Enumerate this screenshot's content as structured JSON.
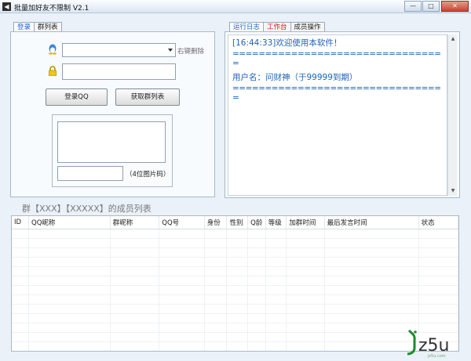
{
  "window": {
    "title": "批量加好友不限制 V2.1",
    "min": "—",
    "max": "□",
    "close": "✕"
  },
  "left_tabs": [
    "登录",
    "群列表"
  ],
  "login": {
    "account_placeholder": "",
    "right_click_delete": "右键删除",
    "password_placeholder": "",
    "login_button": "登录QQ",
    "fetch_groups_button": "获取群列表",
    "captcha_hint": "（4位图片码）"
  },
  "right_tabs": [
    "运行日志",
    "工作台",
    "成员操作"
  ],
  "log": {
    "line1": "[16:44:33]欢迎使用本软件！",
    "line2": "================================",
    "line3": "=",
    "line4": "用户名：问财神（于99999到期）",
    "line5": "================================",
    "line6": "="
  },
  "members": {
    "heading": "群【XXX】【XXXXX】的成员列表",
    "columns": [
      "ID",
      "QQ昵称",
      "群昵称",
      "QQ号",
      "身份",
      "性别",
      "Q龄",
      "等级",
      "加群时间",
      "最后发言时间",
      "状态"
    ]
  },
  "watermark": {
    "text": "jz5u",
    "sub": "jz5u.com"
  },
  "colors": {
    "log_text": "#1f63b5",
    "workbench_tab": "#d31313"
  }
}
